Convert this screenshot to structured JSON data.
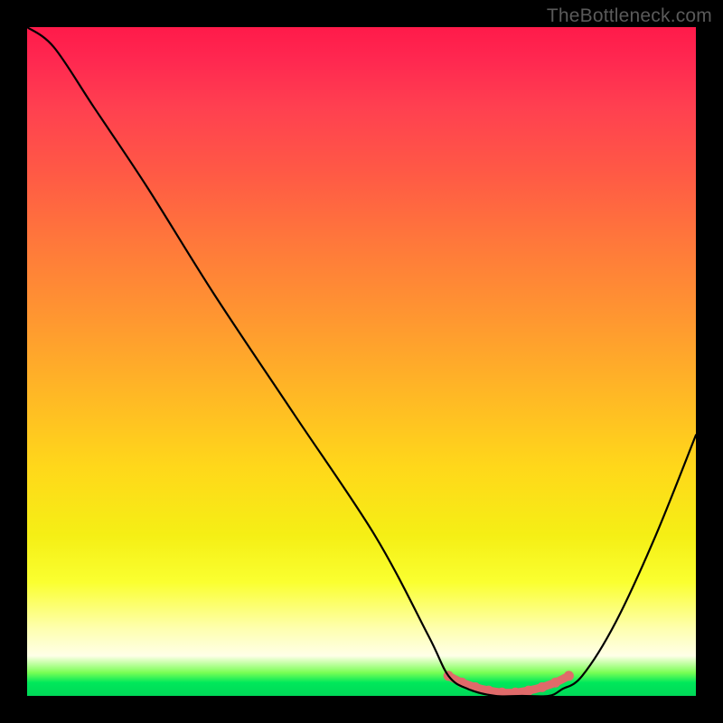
{
  "watermark": "TheBottleneck.com",
  "chart_data": {
    "type": "line",
    "title": "",
    "xlabel": "",
    "ylabel": "",
    "xlim": [
      0,
      100
    ],
    "ylim": [
      0,
      100
    ],
    "series": [
      {
        "name": "bottleneck-curve",
        "x": [
          0,
          4,
          10,
          18,
          28,
          40,
          52,
          60,
          63,
          66,
          70,
          74,
          78,
          80,
          83,
          88,
          94,
          100
        ],
        "values": [
          100,
          97,
          88,
          76,
          60,
          42,
          24,
          9,
          3,
          1,
          0,
          0,
          0,
          1,
          3,
          11,
          24,
          39
        ]
      }
    ],
    "marker_region": {
      "x": [
        63,
        65,
        67,
        69,
        71,
        73,
        75,
        77,
        79,
        81
      ],
      "values": [
        3.0,
        2.0,
        1.3,
        0.8,
        0.5,
        0.5,
        0.8,
        1.3,
        2.0,
        3.0
      ]
    },
    "colors": {
      "curve": "#000000",
      "marker": "#e06a6a",
      "gradient_top": "#ff1a4a",
      "gradient_mid": "#ffd81a",
      "gradient_bottom": "#00d858",
      "background": "#000000"
    }
  }
}
